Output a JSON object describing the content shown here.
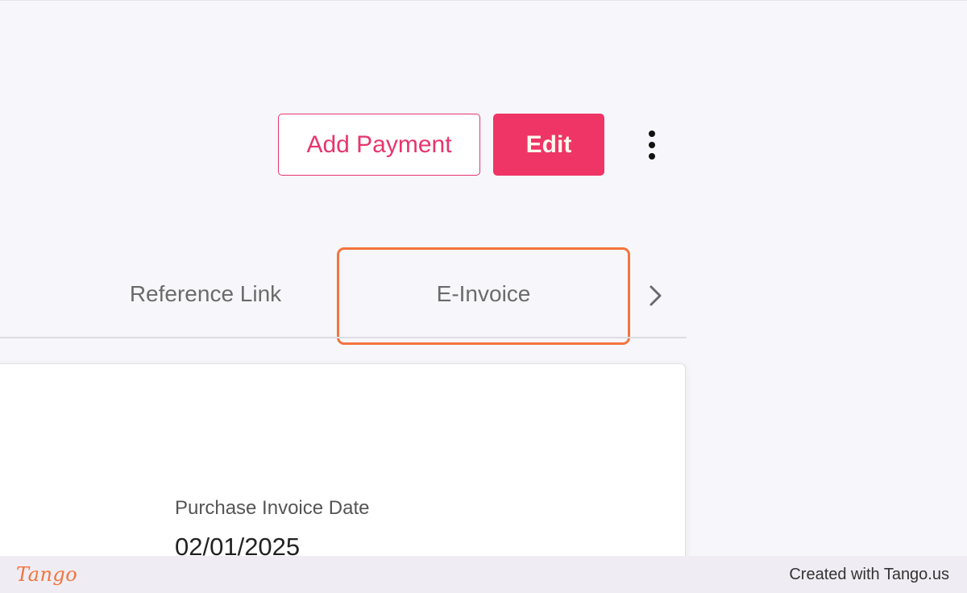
{
  "toolbar": {
    "add_payment_label": "Add Payment",
    "edit_label": "Edit"
  },
  "tabs": [
    {
      "label": "Reference Link"
    },
    {
      "label": "E-Invoice",
      "highlighted": true
    }
  ],
  "card": {
    "fields": [
      {
        "label": "Purchase Invoice Date",
        "value": "02/01/2025"
      }
    ]
  },
  "footer": {
    "logo_text": "Tango",
    "credit_text": "Created with Tango.us"
  },
  "colors": {
    "brand": "#ee3566",
    "highlight": "#f3743e"
  },
  "icons": [
    "more-vertical-icon",
    "chevron-right-icon"
  ]
}
